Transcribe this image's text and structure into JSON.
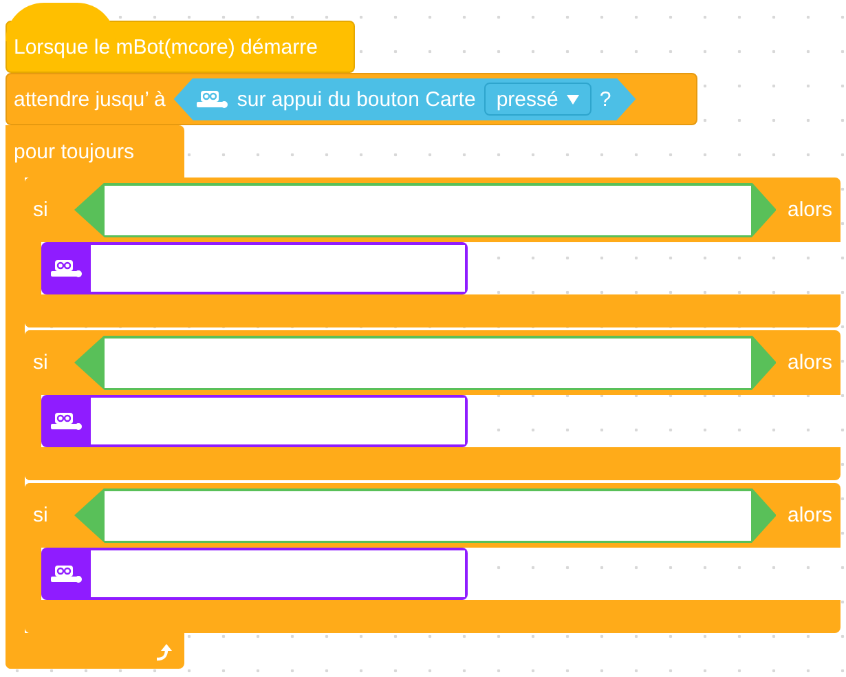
{
  "hat": {
    "label": "Lorsque le mBot(mcore) démarre"
  },
  "wait": {
    "label": "attendre jusqu’ à",
    "sensor": {
      "label": "sur appui du bouton Carte",
      "dropdown": "pressé",
      "suffix": "?"
    }
  },
  "forever": {
    "label": "pour toujours",
    "blocks": [
      {
        "kind": "if",
        "label": "si",
        "then": "alors"
      },
      {
        "kind": "if",
        "label": "si",
        "then": "alors"
      },
      {
        "kind": "if",
        "label": "si",
        "then": "alors"
      }
    ]
  }
}
